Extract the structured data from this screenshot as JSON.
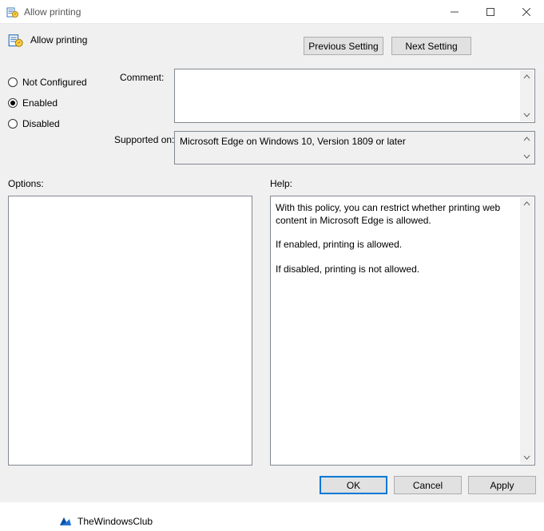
{
  "window": {
    "title": "Allow printing"
  },
  "header": {
    "title": "Allow printing"
  },
  "nav": {
    "prev": "Previous Setting",
    "next": "Next Setting"
  },
  "state": {
    "options": [
      {
        "id": "not-configured",
        "label": "Not Configured",
        "selected": false
      },
      {
        "id": "enabled",
        "label": "Enabled",
        "selected": true
      },
      {
        "id": "disabled",
        "label": "Disabled",
        "selected": false
      }
    ]
  },
  "labels": {
    "comment": "Comment:",
    "supported": "Supported on:",
    "options": "Options:",
    "help": "Help:"
  },
  "comment": "",
  "supported_on": "Microsoft Edge on Windows 10, Version 1809 or later",
  "help": {
    "p1": "With this policy, you can restrict whether printing web content in Microsoft Edge is allowed.",
    "p2": "If enabled, printing is allowed.",
    "p3": "If disabled, printing is not allowed."
  },
  "watermark": "TheWindowsClub",
  "buttons": {
    "ok": "OK",
    "cancel": "Cancel",
    "apply": "Apply"
  }
}
